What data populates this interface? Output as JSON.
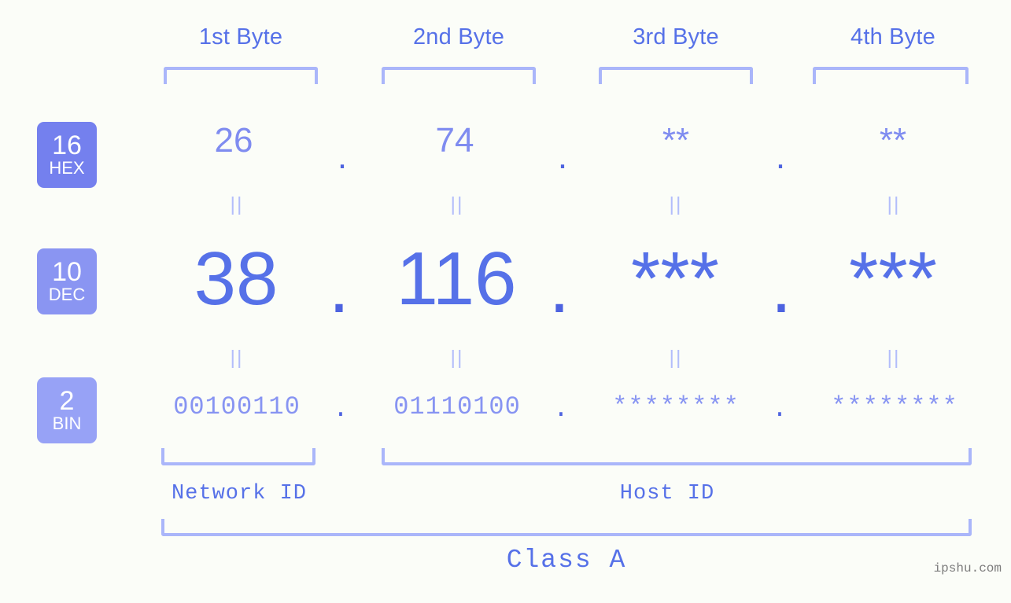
{
  "background_color": "#fbfdf8",
  "accent_color": "#5671e8",
  "bracket_color": "#aab6fa",
  "header": {
    "byte_labels": [
      {
        "text": "1st Byte"
      },
      {
        "text": "2nd Byte"
      },
      {
        "text": "3rd Byte"
      },
      {
        "text": "4th Byte"
      }
    ]
  },
  "bases": [
    {
      "number": "16",
      "abbr": "HEX",
      "color": "#7480ee"
    },
    {
      "number": "10",
      "abbr": "DEC",
      "color": "#8a95f2"
    },
    {
      "number": "2",
      "abbr": "BIN",
      "color": "#97a2f6"
    }
  ],
  "rows": {
    "hex": {
      "base": "16",
      "abbr": "HEX",
      "octets": [
        "26",
        "74",
        "**",
        "**"
      ],
      "separator": "."
    },
    "dec": {
      "base": "10",
      "abbr": "DEC",
      "octets": [
        "38",
        "116",
        "***",
        "***"
      ],
      "separator": "."
    },
    "bin": {
      "base": "2",
      "abbr": "BIN",
      "octets": [
        "00100110",
        "01110100",
        "********",
        "********"
      ],
      "separator": "."
    }
  },
  "connectors": {
    "symbol": "||"
  },
  "footer": {
    "network_id_label": "Network ID",
    "host_id_label": "Host ID",
    "class_label": "Class A"
  },
  "watermark": "ipshu.com"
}
